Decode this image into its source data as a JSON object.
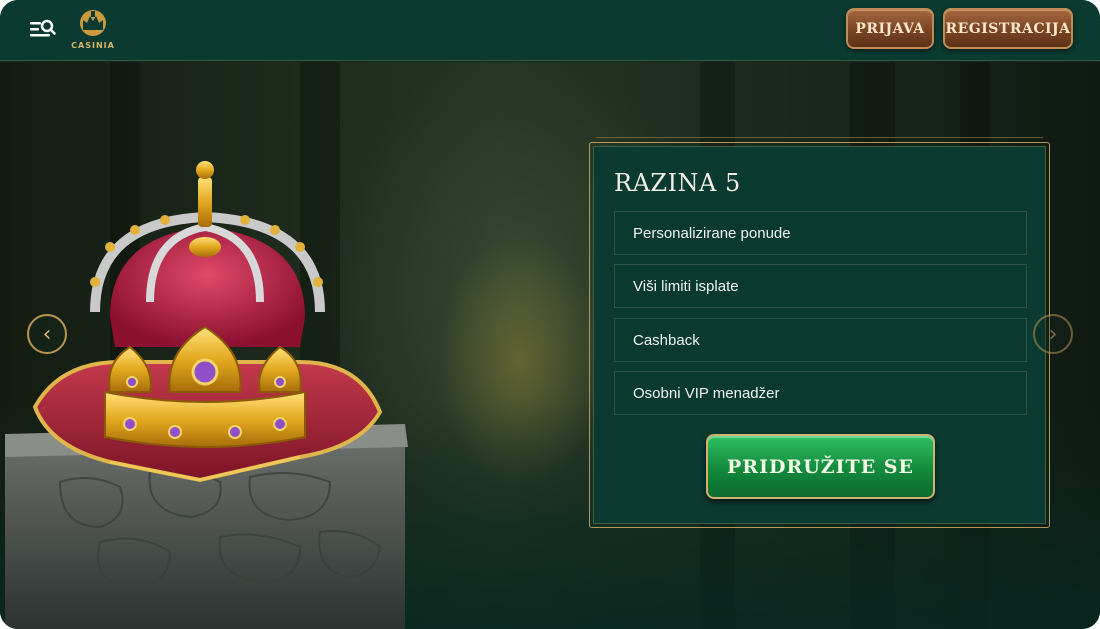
{
  "header": {
    "menu_icon": "menu-search-icon",
    "logo_text": "CASINIA",
    "login_label": "PRIJAVA",
    "register_label": "REGISTRACIJA"
  },
  "colors": {
    "header_bg": "#0b3a30",
    "panel_bg": "#0b3a30",
    "gold": "#b3975a",
    "cta_green": "#138a3d",
    "auth_button": "#7a4424"
  },
  "slider": {
    "prev_icon": "chevron-left-icon",
    "next_icon": "chevron-right-icon",
    "prev_glyph": "‹",
    "next_glyph": "›"
  },
  "level": {
    "title": "RAZINA 5",
    "perks": [
      "Personalizirane ponude",
      "Viši limiti isplate",
      "Cashback",
      "Osobni VIP menadžer"
    ],
    "cta_label": "PRIDRUŽITE SE"
  }
}
